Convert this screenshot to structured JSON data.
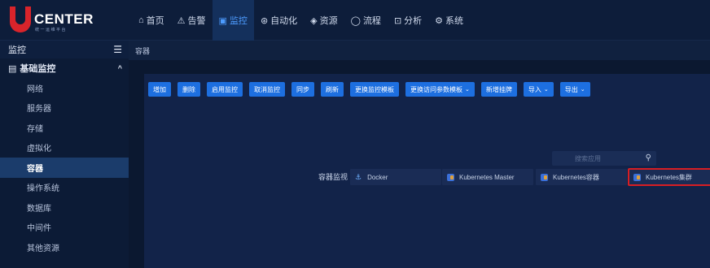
{
  "brand": {
    "name": "CENTER",
    "tagline": "统一运维平台"
  },
  "nav": [
    {
      "icon": "⌂",
      "label": "首页"
    },
    {
      "icon": "⚠",
      "label": "告警"
    },
    {
      "icon": "▣",
      "label": "监控"
    },
    {
      "icon": "⊛",
      "label": "自动化"
    },
    {
      "icon": "◈",
      "label": "资源"
    },
    {
      "icon": "◯",
      "label": "流程"
    },
    {
      "icon": "⊡",
      "label": "分析"
    },
    {
      "icon": "⚙",
      "label": "系统"
    }
  ],
  "sidebar": {
    "title": "监控",
    "collapse_icon": "☰",
    "group": {
      "icon": "▤",
      "label": "基础监控",
      "chevron": "^"
    },
    "items": [
      {
        "label": "网络"
      },
      {
        "label": "服务器"
      },
      {
        "label": "存储"
      },
      {
        "label": "虚拟化"
      },
      {
        "label": "容器"
      },
      {
        "label": "操作系统"
      },
      {
        "label": "数据库"
      },
      {
        "label": "中间件"
      },
      {
        "label": "其他资源"
      }
    ]
  },
  "breadcrumb": "容器",
  "toolbar": [
    {
      "label": "增加"
    },
    {
      "label": "删除"
    },
    {
      "label": "启用监控"
    },
    {
      "label": "取消监控"
    },
    {
      "label": "同步"
    },
    {
      "label": "刷新"
    },
    {
      "label": "更换监控模板"
    },
    {
      "label": "更换访问参数模板",
      "caret": "⌄"
    },
    {
      "label": "新增挂牌"
    },
    {
      "label": "导入",
      "caret": "⌄"
    },
    {
      "label": "导出",
      "caret": "⌄"
    }
  ],
  "search": {
    "placeholder": "搜索应用",
    "icon": "search-icon"
  },
  "filter": {
    "label": "容器监视",
    "options": [
      {
        "label": "Docker",
        "icon": "docker-icon"
      },
      {
        "label": "Kubernetes Master",
        "icon": "kubernetes-icon"
      },
      {
        "label": "Kubernetes容器",
        "icon": "kubernetes-icon"
      },
      {
        "label": "Kubernetes集群",
        "icon": "kubernetes-icon",
        "highlighted": true
      }
    ]
  },
  "colors": {
    "accent": "#1d6fe0",
    "highlight": "#d81e23",
    "brand_red": "#d9242b"
  }
}
